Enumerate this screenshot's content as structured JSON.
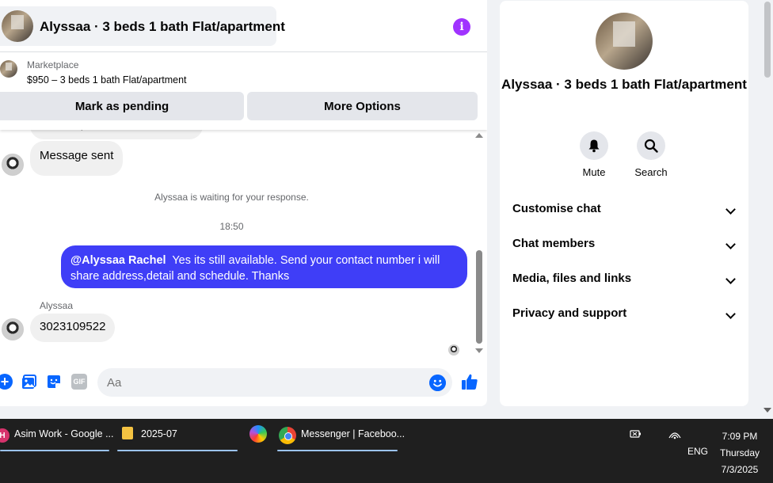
{
  "chat": {
    "title": "Alyssaa · 3 beds 1 bath Flat/apartment",
    "info_glyph": "i",
    "marketplace": {
      "label": "Marketplace",
      "listing": "$950 – 3 beds 1 bath Flat/apartment"
    },
    "buttons": {
      "pending": "Mark as pending",
      "options": "More Options"
    },
    "messages": {
      "partial_text": "Hi Swati, is this still available?",
      "sent_text": "Message sent",
      "waiting_text": "Alyssaa is waiting for your response.",
      "timestamp": "18:50",
      "outgoing_mention": "@Alyssaa Rachel",
      "outgoing_text": "Yes its still available. Send your contact number i will share address,detail and schedule. Thanks",
      "sender_name": "Alyssaa",
      "reply_text": "3023109522"
    },
    "composer": {
      "placeholder": "Aa",
      "plus_glyph": "+",
      "gif_label": "GIF"
    },
    "colors": {
      "outgoing_bubble": "#3f3ef7",
      "accent": "#0866ff",
      "info": "#a033ff"
    }
  },
  "details": {
    "title": "Alyssaa · 3 beds 1 bath Flat/apartment",
    "actions": {
      "mute": "Mute",
      "search": "Search"
    },
    "sections": {
      "customise": "Customise chat",
      "members": "Chat members",
      "media": "Media, files and links",
      "privacy": "Privacy and support"
    }
  },
  "taskbar": {
    "items": {
      "chrome_work": "Asim Work - Google ...",
      "folder": "2025-07",
      "messenger": "Messenger | Faceboo..."
    },
    "badge": "H",
    "tray": {
      "lang": "ENG",
      "time": "7:09 PM",
      "day": "Thursday",
      "date": "7/3/2025"
    }
  }
}
